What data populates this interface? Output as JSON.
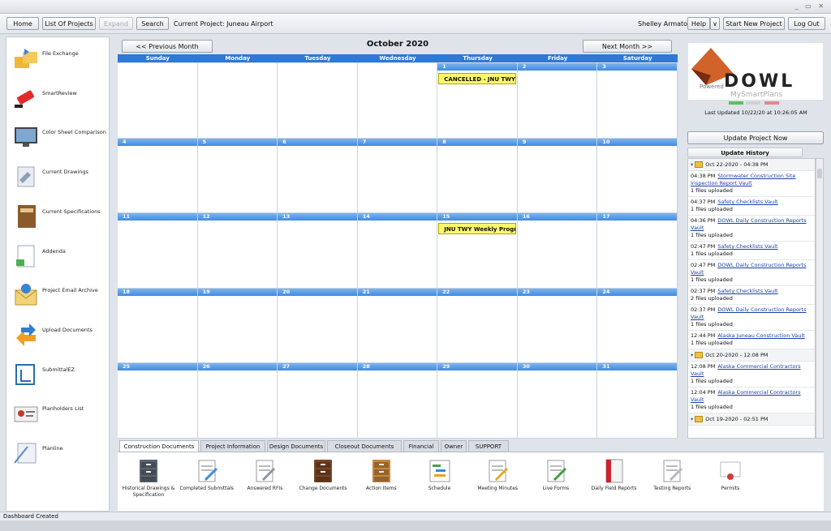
{
  "toolbar": {
    "home": "Home",
    "list_projects": "List Of Projects",
    "expand": "Expand",
    "search": "Search",
    "current_project": "Current Project: Juneau Airport",
    "user": "Shelley Armato",
    "help": "Help",
    "help_caret": "∨",
    "start_new": "Start New Project",
    "logout": "Log Out"
  },
  "sidebar": {
    "items": [
      {
        "label": "File Exchange",
        "icon": "folder-exchange-icon"
      },
      {
        "label": "SmartReview",
        "icon": "marker-icon"
      },
      {
        "label": "Color Sheet Comparison",
        "icon": "monitor-icon"
      },
      {
        "label": "Current Drawings",
        "icon": "drawings-icon"
      },
      {
        "label": "Current Specifications",
        "icon": "specifications-book-icon"
      },
      {
        "label": "Addenda",
        "icon": "addenda-document-icon"
      },
      {
        "label": "Project Email Archive",
        "icon": "email-envelope-icon"
      },
      {
        "label": "Upload Documents",
        "icon": "upload-arrows-icon"
      },
      {
        "label": "SubmittalEZ",
        "icon": "submittal-icon"
      },
      {
        "label": "Planholders List",
        "icon": "id-card-icon"
      },
      {
        "label": "Planline",
        "icon": "planline-icon"
      }
    ]
  },
  "calendar": {
    "prev": "<< Previous Month",
    "next": "Next Month >>",
    "month": "October 2020",
    "days": [
      "Sunday",
      "Monday",
      "Tuesday",
      "Wednesday",
      "Thursday",
      "Friday",
      "Saturday"
    ],
    "weeks": [
      [
        "",
        "",
        "",
        "",
        "1",
        "2",
        "3"
      ],
      [
        "4",
        "5",
        "6",
        "7",
        "8",
        "9",
        "10"
      ],
      [
        "11",
        "12",
        "13",
        "14",
        "15",
        "16",
        "17"
      ],
      [
        "18",
        "19",
        "20",
        "21",
        "22",
        "23",
        "24"
      ],
      [
        "25",
        "26",
        "27",
        "28",
        "29",
        "30",
        "31"
      ]
    ],
    "events": [
      {
        "week": 0,
        "day": 4,
        "text": "CANCELLED - JNU TWY"
      },
      {
        "week": 2,
        "day": 4,
        "text": "JNU TWY Weekly Progr"
      }
    ]
  },
  "tabs": [
    "Construction Documents",
    "Project Information",
    "Design Documents",
    "Closeout Documents",
    "Financial",
    "Owner",
    "SUPPORT"
  ],
  "docs": [
    {
      "label": "Historical Drawings & Specification",
      "icon": "file-cabinet-gray-icon",
      "color": "#5b6470"
    },
    {
      "label": "Completed Submittals",
      "icon": "completed-submittals-icon",
      "color": "#3a8fd8"
    },
    {
      "label": "Answered RFIs",
      "icon": "answered-rfis-icon",
      "color": "#8a96a6"
    },
    {
      "label": "Change Documents",
      "icon": "file-cabinet-brown-icon",
      "color": "#7a4526"
    },
    {
      "label": "Action Items",
      "icon": "file-cabinet-orange-icon",
      "color": "#c9853b"
    },
    {
      "label": "Schedule",
      "icon": "schedule-gantt-icon",
      "color": "#4aa04a"
    },
    {
      "label": "Meeting Minutes",
      "icon": "meeting-notebook-icon",
      "color": "#e6a91d"
    },
    {
      "label": "Live Forms",
      "icon": "live-forms-icon",
      "color": "#3e9d3e"
    },
    {
      "label": "Daily Field Reports",
      "icon": "daily-report-binder-icon",
      "color": "#c8242f"
    },
    {
      "label": "Testing Reports",
      "icon": "testing-reports-icon",
      "color": "#b4b8be"
    },
    {
      "label": "Permits",
      "icon": "certificate-icon",
      "color": "#d23b3b"
    }
  ],
  "right": {
    "logo_text": "DOWL",
    "logo_powered": "Powered",
    "logo_brand": "MySmartPlans",
    "last_updated": "Last Updated 10/22/20 at 10:26:05 AM",
    "update_now": "Update Project Now",
    "history_title": "Update History",
    "history": [
      {
        "type": "group",
        "text": "Oct 22-2020 - 04:38 PM"
      },
      {
        "type": "entry",
        "time": "04:38 PM",
        "link": "Stormwater Construction Site Inspection Report Vault",
        "note": "1 files uploaded"
      },
      {
        "type": "entry",
        "time": "04:37 PM",
        "link": "Safety Checklists Vault",
        "note": "1 files uploaded"
      },
      {
        "type": "entry",
        "time": "04:36 PM",
        "link": "DOWL Daily Construction Reports Vault",
        "note": "1 files uploaded"
      },
      {
        "type": "entry",
        "time": "02:47 PM",
        "link": "Safety Checklists Vault",
        "note": "1 files uploaded"
      },
      {
        "type": "entry",
        "time": "02:47 PM",
        "link": "DOWL Daily Construction Reports Vault",
        "note": "1 files uploaded"
      },
      {
        "type": "entry",
        "time": "02:37 PM",
        "link": "Safety Checklists Vault",
        "note": "2 files uploaded"
      },
      {
        "type": "entry",
        "time": "02:37 PM",
        "link": "DOWL Daily Construction Reports Vault",
        "note": "1 files uploaded"
      },
      {
        "type": "entry",
        "time": "12:44 PM",
        "link": "Alaska Juneau Construction Vault",
        "note": "1 files uploaded"
      },
      {
        "type": "group",
        "text": "Oct 20-2020 - 12:08 PM"
      },
      {
        "type": "entry",
        "time": "12:08 PM",
        "link": "Alaska Commercial Contractors Vault",
        "note": "1 files uploaded"
      },
      {
        "type": "entry",
        "time": "12:04 PM",
        "link": "Alaska Commercial Contractors Vault",
        "note": "1 files uploaded"
      },
      {
        "type": "group",
        "text": "Oct 19-2020 - 02:51 PM"
      }
    ]
  },
  "status": {
    "text": "Dashboard Created"
  },
  "colors": {
    "header_blue": "#2e78d8",
    "event_yellow": "#fdf86a",
    "link_blue": "#1a3fa8",
    "brand_orange": "#d0622a"
  }
}
